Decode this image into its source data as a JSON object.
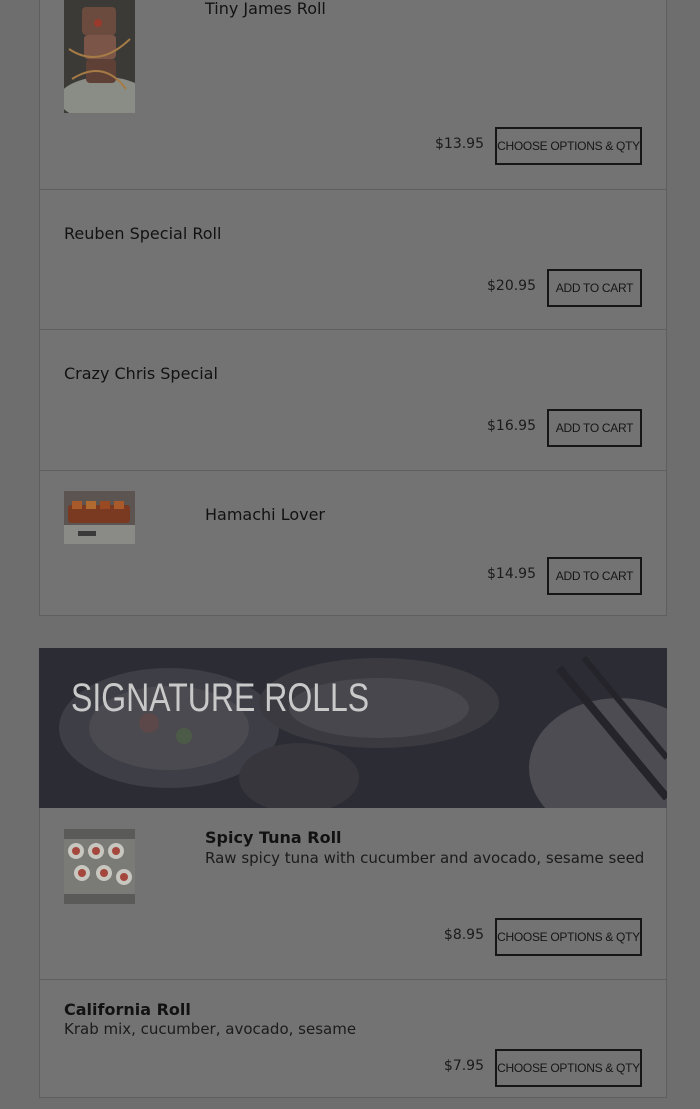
{
  "section1": {
    "items": [
      {
        "name": "Tiny James Roll",
        "price": "$13.95",
        "button": "CHOOSE OPTIONS & QTY"
      },
      {
        "name": "Reuben Special Roll",
        "price": "$20.95",
        "button": "ADD TO CART"
      },
      {
        "name": "Crazy Chris Special",
        "price": "$16.95",
        "button": "ADD TO CART"
      },
      {
        "name": "Hamachi Lover",
        "price": "$14.95",
        "button": "ADD TO CART"
      }
    ]
  },
  "section2": {
    "title": "SIGNATURE ROLLS",
    "items": [
      {
        "name": "Spicy Tuna Roll",
        "description": "Raw spicy tuna with cucumber and avocado, sesame seed",
        "price": "$8.95",
        "button": "CHOOSE OPTIONS & QTY"
      },
      {
        "name": "California Roll",
        "description": "Krab mix, cucumber, avocado, sesame",
        "price": "$7.95",
        "button": "CHOOSE OPTIONS & QTY"
      }
    ]
  }
}
